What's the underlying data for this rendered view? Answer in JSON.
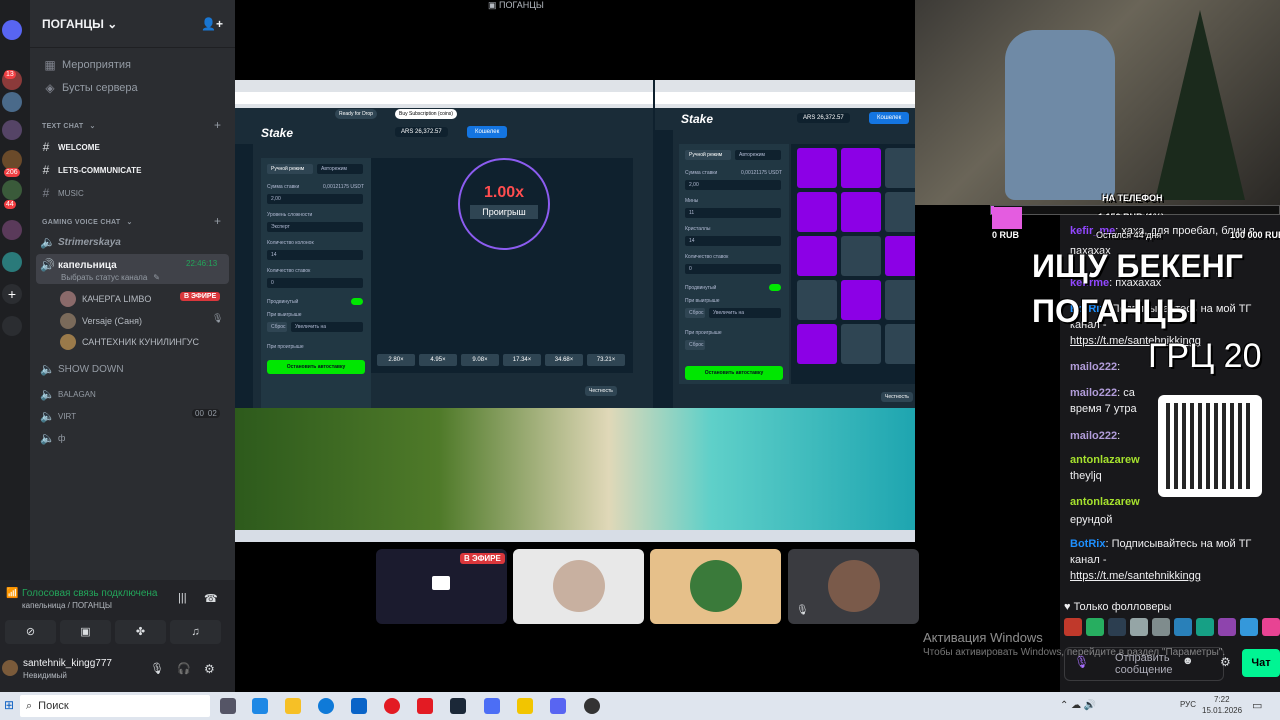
{
  "window": {
    "stream_title": "ПОГАНЦЫ"
  },
  "server": {
    "name": "ПОГАНЦЫ",
    "events": "Мероприятия",
    "boosts": "Бусты сервера",
    "text_category": "TEXT CHAT",
    "text_channels": [
      "WELCOME",
      "LETS-COMMUNICATE",
      "MUSIC"
    ],
    "voice_category": "GAMING VOICE CHAT",
    "voice_channels": {
      "strimerskaya": "Strimerskaya",
      "kapelnitsa": "капельница",
      "kapelnitsa_time": "22:46:13",
      "kapelnitsa_status": "Выбрать статус канала",
      "show_down": "SHOW DOWN",
      "balagan": "BALAGAN",
      "virt": "VIRT",
      "virt_count_a": "00",
      "virt_count_b": "02",
      "phi": "ф"
    },
    "users": [
      {
        "name": "КАЧЕРГА LIMBO",
        "badge": "В ЭФИРЕ"
      },
      {
        "name": "Versaje (Саня)"
      },
      {
        "name": "САНТЕХНИК КУНИЛИНГУС"
      }
    ]
  },
  "rail_badges": [
    "13",
    "206",
    "44"
  ],
  "voice": {
    "status": "Голосовая связь подключена",
    "channel": "капельница / ПОГАНЦЫ",
    "username": "santehnik_kingg777",
    "user_status": "Невидимый"
  },
  "stake_left": {
    "logo": "Stake",
    "balance": "ARS 26,372.57",
    "wallet": "Кошелек",
    "mode_manual": "Ручной режим",
    "mode_auto": "Авторежим",
    "bet_label": "Сумма ставки",
    "bet_value": "2,00",
    "bet_usdt": "0,00121175 USDT",
    "difficulty_label": "Уровень сложности",
    "difficulty_value": "Эксперт",
    "count_label": "Количество колонок",
    "count_value": "14",
    "bets_label": "Количество ставок",
    "bets_value": "0",
    "advanced": "Продвинутый",
    "on_win": "При выигрыше",
    "on_loss": "При проигрыше",
    "reset": "Сброс",
    "increase": "Увеличить на",
    "stop_btn": "Остановить автоставку",
    "multiplier": "1.00x",
    "result": "Проигрыш",
    "steps": [
      "2.80×",
      "4.95×",
      "9.08×",
      "17.34×",
      "34.68×",
      "73.21×"
    ],
    "fairness": "Честность",
    "tag_ready": "Ready for Drop",
    "tag_buy": "Buy Subscription (coins)"
  },
  "stake_right": {
    "logo": "Stake",
    "balance": "ARS 26,372.57",
    "wallet": "Кошелек",
    "mode_manual": "Ручной режим",
    "mode_auto": "Авторежим",
    "bet_label": "Сумма ставки",
    "bet_value": "2,00",
    "bet_usdt": "0,00121175 USDT",
    "mines_label": "Мины",
    "mines_value": "11",
    "gems_label": "Кристаллы",
    "gems_value": "14",
    "bets_label": "Количество ставок",
    "bets_value": "0",
    "advanced": "Продвинутый",
    "on_win": "При выигрыше",
    "on_loss": "При проигрыше",
    "reset": "Сброс",
    "increase": "Увеличить на",
    "stop_btn": "Остановить автоставку",
    "fairness": "Честность",
    "grid": [
      [
        1,
        1,
        0,
        0,
        0
      ],
      [
        1,
        1,
        0,
        1,
        0
      ],
      [
        1,
        0,
        1,
        0,
        0
      ],
      [
        0,
        1,
        0,
        1,
        1
      ],
      [
        1,
        0,
        0,
        0,
        1
      ]
    ]
  },
  "overlay": {
    "phone": "НА ТЕЛЕФОН",
    "donation": "1 150 RUB (1%)",
    "zero": "0 RUB",
    "left": "Остался 44 дня",
    "goal": "100 000 RUB",
    "headline1": "ИЩУ БЕКЕНГ",
    "headline2": "ПОГАНЦЫ",
    "grts": "ГРЦ 20"
  },
  "chat": {
    "lines": [
      {
        "user": "kefir_me",
        "text": ": хаха, для проебал, блин я"
      },
      {
        "user": "",
        "text": "пахахах"
      },
      {
        "user": "kefirme",
        "text": ": пхахахах"
      },
      {
        "user": "BotRix",
        "text": ": Подписывайтесь на мой ТГ канал -"
      },
      {
        "user": "",
        "text": "https://t.me/santehnikkingg"
      },
      {
        "user": "mailo222",
        "text": ":"
      },
      {
        "user": "mailo222",
        "text": ": са"
      },
      {
        "user": "",
        "text": "время 7 утра"
      },
      {
        "user": "mailo222",
        "text": ":"
      },
      {
        "user": "antonlazarew",
        "text": ""
      },
      {
        "user": "",
        "text": "theyljq"
      },
      {
        "user": "antonlazarew",
        "text": ""
      },
      {
        "user": "",
        "text": "ерундой"
      },
      {
        "user": "BotRix",
        "text": ": Подписывайтесь на мой ТГ канал -"
      },
      {
        "user": "",
        "text": "https://t.me/santehnikkingg"
      }
    ],
    "followers_only": "Только фолловеры",
    "send_placeholder": "Отправить сообщение",
    "chat_button": "Чат"
  },
  "participants": {
    "live_badge": "В ЭФИРЕ"
  },
  "windows": {
    "activation_title": "Активация Windows",
    "activation_text": "Чтобы активировать Windows, перейдите в раздел \"Параметры\".",
    "search": "Поиск",
    "lang": "РУС",
    "time": "7:22",
    "date": "15.01.2026"
  },
  "colors": {
    "discord_bg": "#2b2d31",
    "stake_green": "#00e701",
    "mine_purple": "#8c00e6",
    "live_red": "#da373c"
  }
}
